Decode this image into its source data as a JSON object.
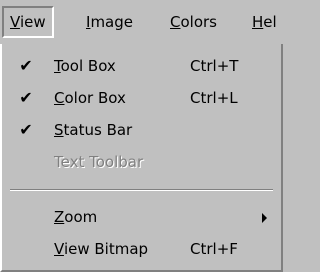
{
  "menubar": {
    "items": [
      {
        "label": "View"
      },
      {
        "label": "Image"
      },
      {
        "label": "Colors"
      },
      {
        "label": "Hel"
      }
    ]
  },
  "view_menu": {
    "items": [
      {
        "label": "Tool Box",
        "shortcut": "Ctrl+T",
        "checked": true,
        "enabled": true
      },
      {
        "label": "Color Box",
        "shortcut": "Ctrl+L",
        "checked": true,
        "enabled": true
      },
      {
        "label": "Status Bar",
        "shortcut": "",
        "checked": true,
        "enabled": true
      },
      {
        "label": "Text Toolbar",
        "shortcut": "",
        "checked": false,
        "enabled": false
      },
      {
        "label": "Zoom",
        "shortcut": "",
        "checked": false,
        "enabled": true,
        "submenu": true
      },
      {
        "label": "View Bitmap",
        "shortcut": "Ctrl+F",
        "checked": false,
        "enabled": true
      }
    ],
    "check_glyph": "✔"
  }
}
